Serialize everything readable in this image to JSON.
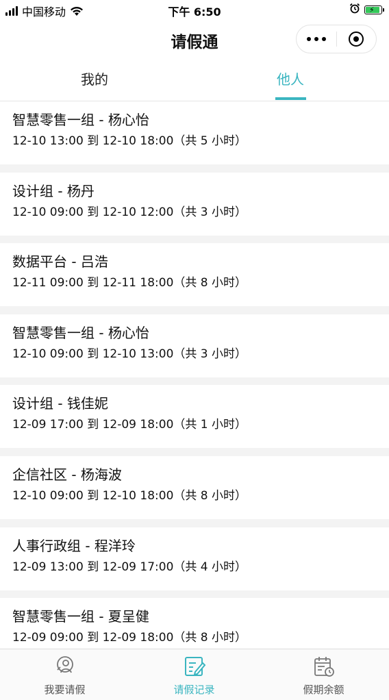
{
  "status_bar": {
    "carrier": "中国移动",
    "time": "下午 6:50"
  },
  "nav": {
    "title": "请假通"
  },
  "tabs": [
    {
      "label": "我的",
      "active": false
    },
    {
      "label": "他人",
      "active": true
    }
  ],
  "records": [
    {
      "title": "智慧零售一组 - 杨心怡",
      "time": "12-10 13:00 到 12-10 18:00（共 5 小时）"
    },
    {
      "title": "设计组 - 杨丹",
      "time": "12-10 09:00 到 12-10 12:00（共 3 小时）"
    },
    {
      "title": "数据平台 - 吕浩",
      "time": "12-11 09:00 到 12-11 18:00（共 8 小时）"
    },
    {
      "title": "智慧零售一组 - 杨心怡",
      "time": "12-10 09:00 到 12-10 13:00（共 3 小时）"
    },
    {
      "title": "设计组 - 钱佳妮",
      "time": "12-09 17:00 到 12-09 18:00（共 1 小时）"
    },
    {
      "title": "企信社区 - 杨海波",
      "time": "12-10 09:00 到 12-10 18:00（共 8 小时）"
    },
    {
      "title": "人事行政组 - 程洋玲",
      "time": "12-09 13:00 到 12-09 17:00（共 4 小时）"
    },
    {
      "title": "智慧零售一组 - 夏呈健",
      "time": "12-09 09:00 到 12-09 18:00（共 8 小时）"
    }
  ],
  "tabbar": [
    {
      "label": "我要请假",
      "icon": "person-request-icon",
      "active": false
    },
    {
      "label": "请假记录",
      "icon": "edit-record-icon",
      "active": true
    },
    {
      "label": "假期余额",
      "icon": "calendar-clock-icon",
      "active": false
    }
  ],
  "colors": {
    "accent": "#3ab5c0",
    "separator": "#f3f3f3",
    "battery": "#34c759"
  }
}
